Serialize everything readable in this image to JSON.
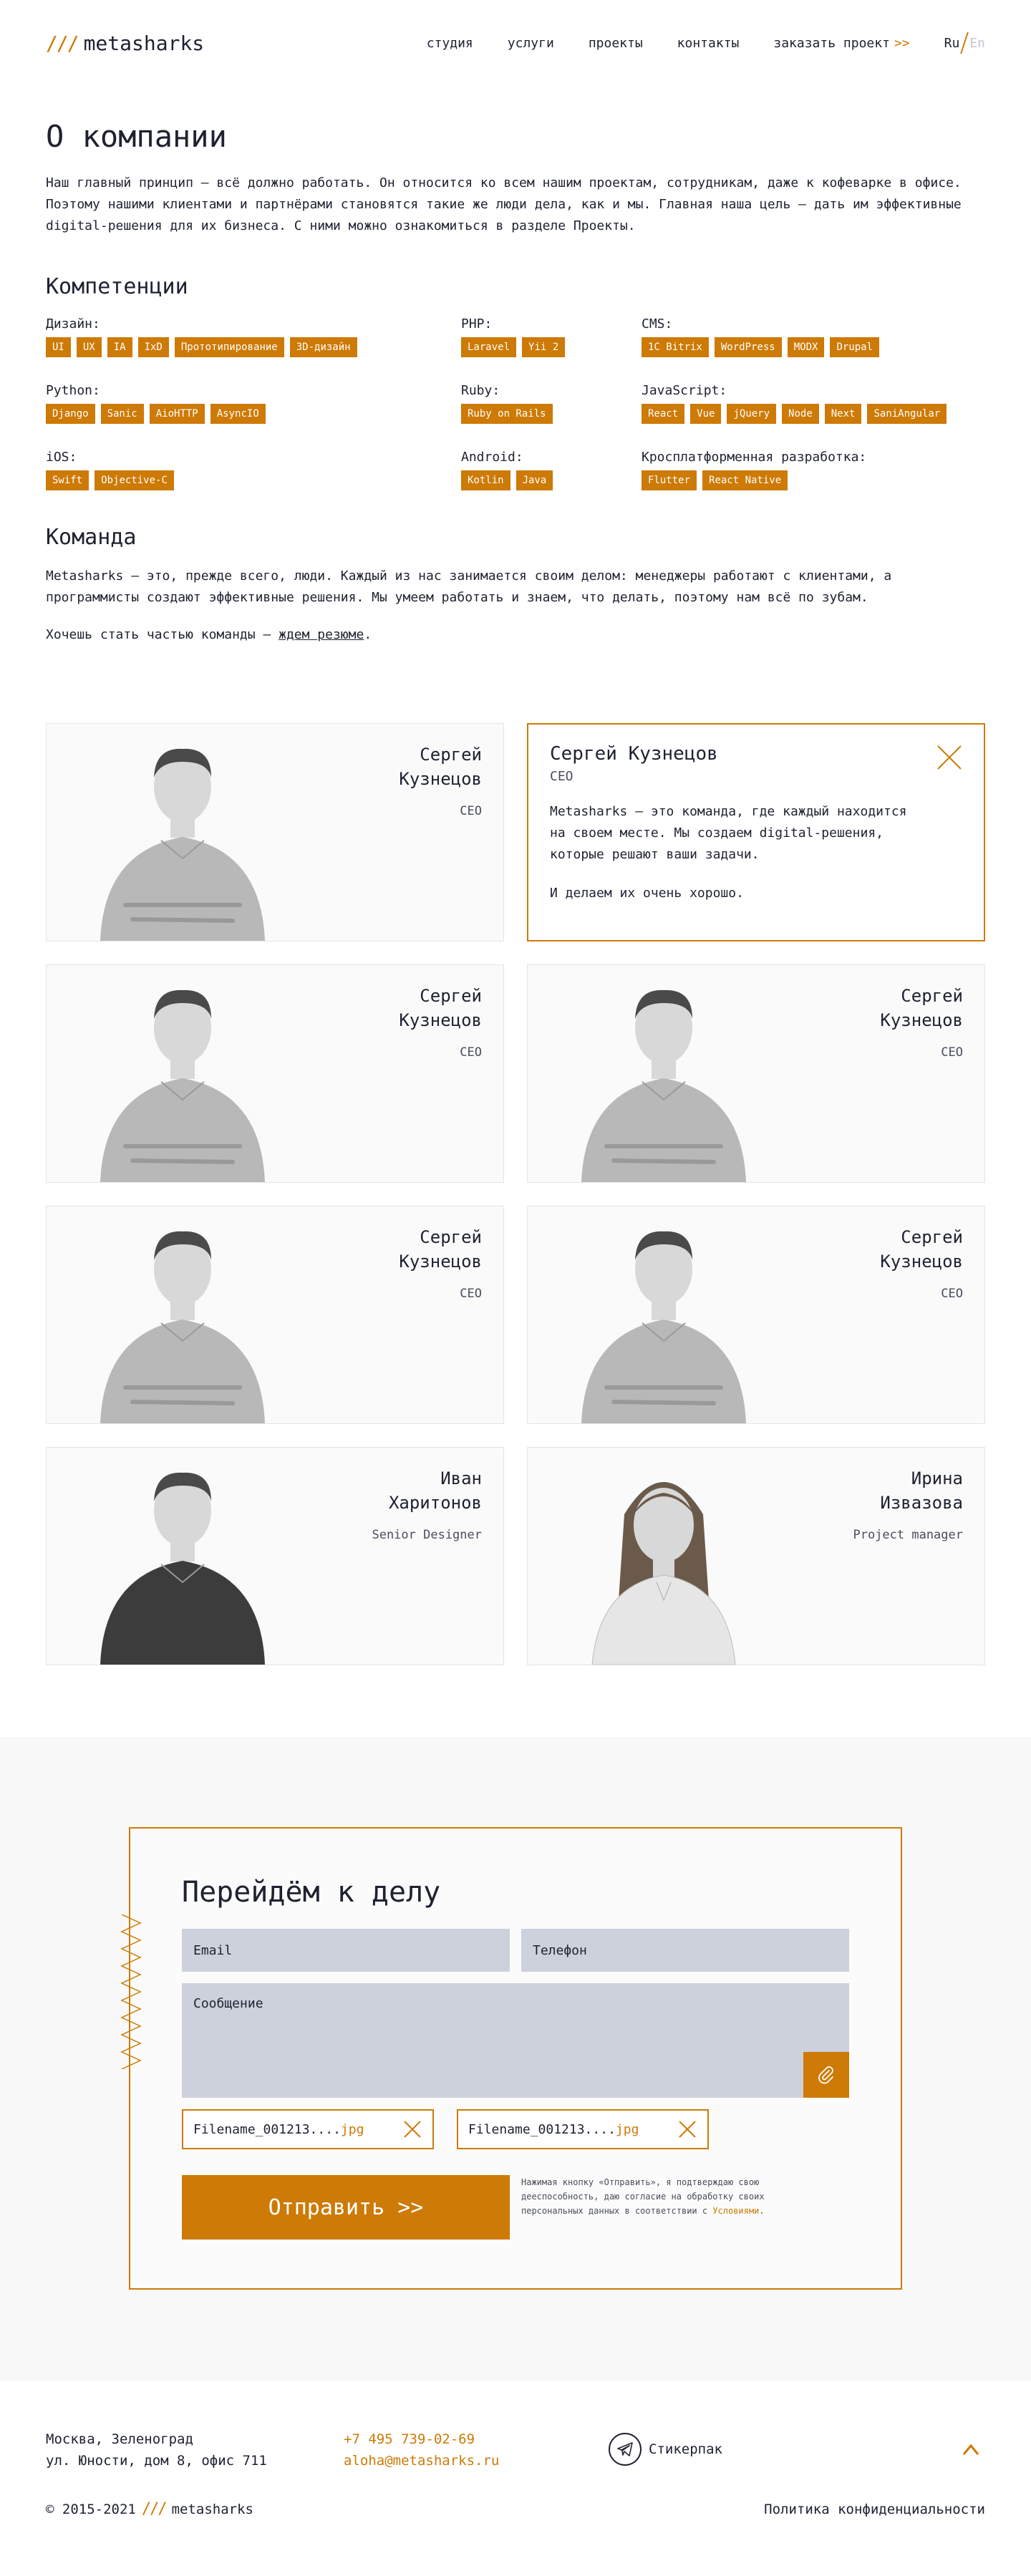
{
  "header": {
    "logo_mark": "///",
    "logo_text": "metasharks",
    "nav": [
      "студия",
      "услуги",
      "проекты",
      "контакты"
    ],
    "order_label": "заказать проект",
    "order_arrow": ">>",
    "lang_active": "Ru",
    "lang_inactive": "En"
  },
  "about": {
    "title": "О компании",
    "text": "Наш главный принцип — всё должно работать. Он относится ко всем нашим проектам, сотрудникам, даже к кофеварке в офисе. Поэтому нашими клиентами и партнёрами становятся такие же люди дела, как и мы. Главная наша цель — дать им эффективные digital-решения для их бизнеса. С ними можно ознакомиться в разделе Проекты."
  },
  "competencies": {
    "title": "Компетенции",
    "groups": [
      {
        "title": "Дизайн:",
        "tags": [
          "UI",
          "UX",
          "IA",
          "IxD",
          "Прототипирование",
          "3D-дизайн"
        ]
      },
      {
        "title": "PHP:",
        "tags": [
          "Laravel",
          "Yii 2"
        ]
      },
      {
        "title": "CMS:",
        "tags": [
          "1C Bitrix",
          "WordPress",
          "MODX",
          "Drupal"
        ]
      },
      {
        "title": "Python:",
        "tags": [
          "Django",
          "Sanic",
          "AioHTTP",
          "AsyncIO"
        ]
      },
      {
        "title": "Ruby:",
        "tags": [
          "Ruby on Rails"
        ]
      },
      {
        "title": "JavaScript:",
        "tags": [
          "React",
          "Vue",
          "jQuery",
          "Node",
          "Next",
          "SaniAngular"
        ]
      },
      {
        "title": "iOS:",
        "tags": [
          "Swift",
          "Objective-C"
        ]
      },
      {
        "title": "Android:",
        "tags": [
          "Kotlin",
          "Java"
        ]
      },
      {
        "title": "Кросплатформенная разработка:",
        "tags": [
          "Flutter",
          "React Native"
        ]
      }
    ]
  },
  "team": {
    "title": "Команда",
    "text": "Metasharks — это, прежде всего, люди. Каждый из нас занимается своим делом: менеджеры работают с клиентами, а программисты создают эффективные решения. Мы умеем работать и знаем, что делать, поэтому нам всё по зубам.",
    "join_prefix": "Хочешь стать частью команды — ",
    "join_link": "ждем резюме",
    "join_suffix": ".",
    "members": [
      {
        "name": "Сергей Кузнецов",
        "role": "CEO",
        "photo": "man-short-hair"
      },
      {
        "name": "Сергей Кузнецов",
        "role": "CEO",
        "photo": "man-short-hair"
      },
      {
        "name": "Сергей Кузнецов",
        "role": "CEO",
        "photo": "man-short-hair"
      },
      {
        "name": "Сергей Кузнецов",
        "role": "CEO",
        "photo": "man-short-hair"
      },
      {
        "name": "Сергей Кузнецов",
        "role": "CEO",
        "photo": "man-short-hair"
      },
      {
        "name": "Иван Харитонов",
        "role": "Senior Designer",
        "photo": "man-tshirt"
      },
      {
        "name": "Ирина Извазова",
        "role": "Project manager",
        "photo": "woman-long-hair"
      }
    ],
    "open_card": {
      "name": "Сергей Кузнецов",
      "role": "CEO",
      "text1": "Metasharks — это команда, где каждый находится на своем месте. Мы создаем digital-решения, которые решают ваши задачи.",
      "text2": "И делаем их очень хорошо."
    }
  },
  "contact": {
    "title": "Перейдём к делу",
    "email_placeholder": "Email",
    "phone_placeholder": "Телефон",
    "message_placeholder": "Сообщение",
    "files": [
      {
        "name": "Filename_001213....",
        "ext": "jpg"
      },
      {
        "name": "Filename_001213....",
        "ext": "jpg"
      }
    ],
    "submit_label": "Отправить >>",
    "consent_text": "Нажимая кнопку «Отправить», я подтверждаю свою дееспособность, даю согласие на обработку своих персональных данных в соответствии с ",
    "consent_link": "Условиями",
    "consent_end": "."
  },
  "footer": {
    "address_line1": "Москва, Зеленоград",
    "address_line2": "ул. Юности, дом 8, офис 711",
    "phone": "+7 495 739-02-69",
    "email": "aloha@metasharks.ru",
    "sticker_label": "Стикерпак",
    "copyright": "© 2015-2021",
    "logo_mark": "///",
    "logo_text": "metasharks",
    "policy": "Политика конфиденциальности"
  },
  "colors": {
    "accent": "#cd7a06",
    "text": "#1e2230",
    "field": "#cdd1dc"
  }
}
